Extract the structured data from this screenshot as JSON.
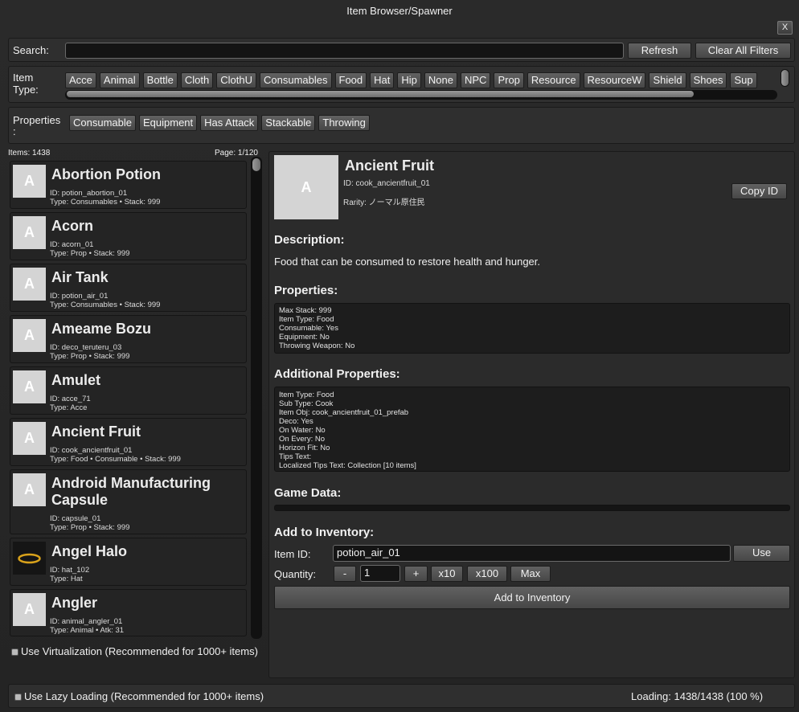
{
  "window": {
    "title": "Item Browser/Spawner",
    "close_label": "X"
  },
  "search": {
    "label": "Search:",
    "value": "",
    "refresh_label": "Refresh",
    "clear_label": "Clear All Filters"
  },
  "item_type": {
    "label_line1": "Item",
    "label_line2": "Type:",
    "chips": [
      "Acce",
      "Animal",
      "Bottle",
      "Cloth",
      "ClothU",
      "Consumables",
      "Food",
      "Hat",
      "Hip",
      "None",
      "NPC",
      "Prop",
      "Resource",
      "ResourceW",
      "Shield",
      "Shoes",
      "Sup"
    ]
  },
  "properties_filter": {
    "label_line1": "Properties",
    "label_line2": ":",
    "chips": [
      "Consumable",
      "Equipment",
      "Has Attack",
      "Stackable",
      "Throwing"
    ]
  },
  "list": {
    "count_label": "Items: 1438",
    "page_label": "Page: 1/120",
    "items": [
      {
        "name": "Abortion Potion",
        "id": "ID: potion_abortion_01",
        "type": "Type: Consumables • Stack: 999",
        "thumb": "A"
      },
      {
        "name": "Acorn",
        "id": "ID: acorn_01",
        "type": "Type: Prop • Stack: 999",
        "thumb": "A"
      },
      {
        "name": "Air Tank",
        "id": "ID: potion_air_01",
        "type": "Type: Consumables • Stack: 999",
        "thumb": "A"
      },
      {
        "name": "Ameame Bozu",
        "id": "ID: deco_teruteru_03",
        "type": "Type: Prop • Stack: 999",
        "thumb": "A"
      },
      {
        "name": "Amulet",
        "id": "ID: acce_71",
        "type": "Type: Acce",
        "thumb": "A"
      },
      {
        "name": "Ancient Fruit",
        "id": "ID: cook_ancientfruit_01",
        "type": "Type: Food • Consumable • Stack: 999",
        "thumb": "A"
      },
      {
        "name": "Android Manufacturing",
        "name2": "Capsule",
        "id": "ID: capsule_01",
        "type": "Type: Prop • Stack: 999",
        "thumb": "A"
      },
      {
        "name": "Angel Halo",
        "id": "ID: hat_102",
        "type": "Type: Hat",
        "thumb": "halo-icon"
      },
      {
        "name": "Angler",
        "id": "ID: animal_angler_01",
        "type": "Type: Animal • Atk: 31",
        "thumb": "A"
      }
    ],
    "virtualization_label": "Use Virtualization (Recommended for 1000+ items)"
  },
  "detail": {
    "thumb": "A",
    "name": "Ancient Fruit",
    "id": "ID: cook_ancientfruit_01",
    "rarity": "Rarity: ノーマル原住民",
    "copy_label": "Copy ID",
    "description_title": "Description:",
    "description": "Food that can be consumed to restore health and hunger.",
    "properties_title": "Properties:",
    "properties": [
      "Max Stack: 999",
      "Item Type: Food",
      "Consumable: Yes",
      "Equipment: No",
      "Throwing Weapon: No"
    ],
    "additional_title": "Additional Properties:",
    "additional": [
      "Item Type: Food",
      "Sub Type: Cook",
      "Item Obj: cook_ancientfruit_01_prefab",
      "Deco: Yes",
      "On Water: No",
      "On Every: No",
      "Horizon Fit: No",
      "Tips Text:",
      "Localized Tips Text: Collection [10 items]"
    ],
    "game_data_title": "Game Data:"
  },
  "inventory": {
    "title": "Add to Inventory:",
    "item_id_label": "Item ID:",
    "item_id_value": "potion_air_01",
    "use_label": "Use",
    "quantity_label": "Quantity:",
    "quantity_value": "1",
    "minus_label": "-",
    "plus_label": "+",
    "x10_label": "x10",
    "x100_label": "x100",
    "max_label": "Max",
    "add_label": "Add to Inventory"
  },
  "footer": {
    "lazy_label": "Use Lazy Loading (Recommended for 1000+ items)",
    "loading_label": "Loading: 1438/1438 (100 %)"
  },
  "colors": {
    "background": "#242424",
    "panel": "#2f2f2f",
    "button": "#545454",
    "input_bg": "#141414",
    "thumb": "#d4d4d4",
    "halo": "#d9a21b"
  }
}
